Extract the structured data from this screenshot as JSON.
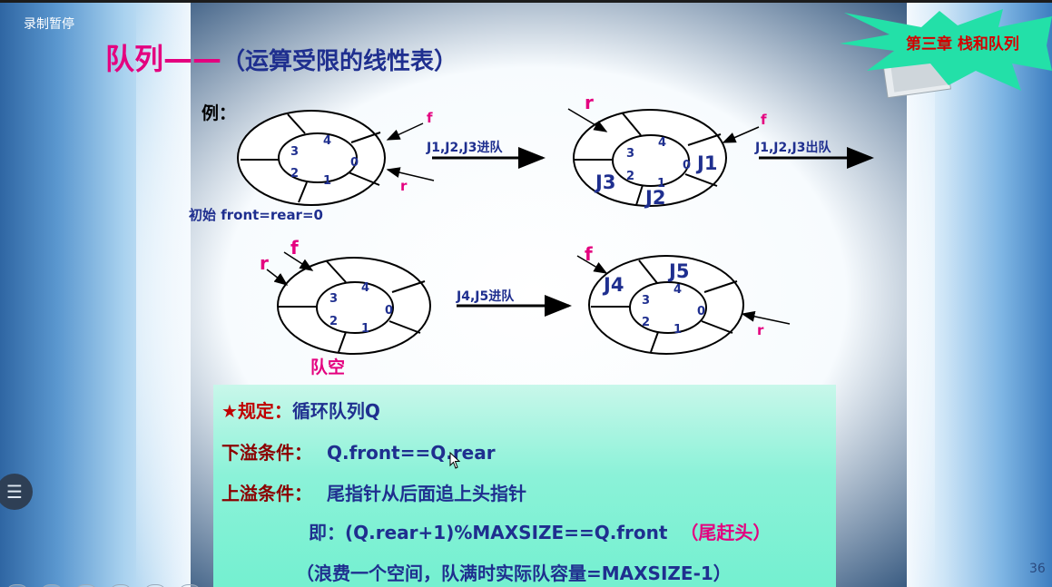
{
  "recorder": {
    "status": "录制暂停"
  },
  "slide": {
    "title_main": "队列",
    "title_dash": "——",
    "title_sub": "（运算受限的线性表）",
    "chapter_badge": "第三章 栈和队列",
    "page_number": "36",
    "example_label": "例：",
    "colors": {
      "title": "#e4007f",
      "body": "#1f2f8f",
      "accent": "#8b0000",
      "badge": "#d40000",
      "panel": "#7ff0d4"
    }
  },
  "diagram": {
    "queue1": {
      "caption": "初始 front=rear=0",
      "front_label": "f",
      "rear_label": "r",
      "slot_numbers": [
        "0",
        "1",
        "2",
        "3",
        "4"
      ]
    },
    "transition1": {
      "label": "J1,J2,J3进队"
    },
    "queue2": {
      "front_label": "f",
      "rear_label": "r",
      "slot_numbers": [
        "0",
        "1",
        "2",
        "3",
        "4"
      ],
      "elements": [
        "J1",
        "J2",
        "J3"
      ]
    },
    "transition2": {
      "label": "J1,J2,J3出队"
    },
    "queue3": {
      "caption": "队空",
      "front_label": "f",
      "rear_label": "r",
      "slot_numbers": [
        "0",
        "1",
        "2",
        "3",
        "4"
      ]
    },
    "transition3": {
      "label": "J4,J5进队"
    },
    "queue4": {
      "front_label": "f",
      "rear_label": "r",
      "slot_numbers": [
        "0",
        "1",
        "2",
        "3",
        "4"
      ],
      "elements": [
        "J4",
        "J5"
      ]
    }
  },
  "rules": {
    "heading_star": "★",
    "heading_label": "规定：",
    "heading_text": "循环队列Q",
    "underflow_label": "下溢条件：",
    "underflow_text": "Q.front==Q.rear",
    "overflow_label": "上溢条件：",
    "overflow_text": "尾指针从后面追上头指针",
    "overflow_formula": "即：(Q.rear+1)%MAXSIZE==Q.front",
    "overflow_note_open": "（",
    "overflow_note": "尾赶头",
    "overflow_note_close": "）",
    "waste_note": "（浪费一个空间，队满时实际队容量=MAXSIZE-1）"
  }
}
